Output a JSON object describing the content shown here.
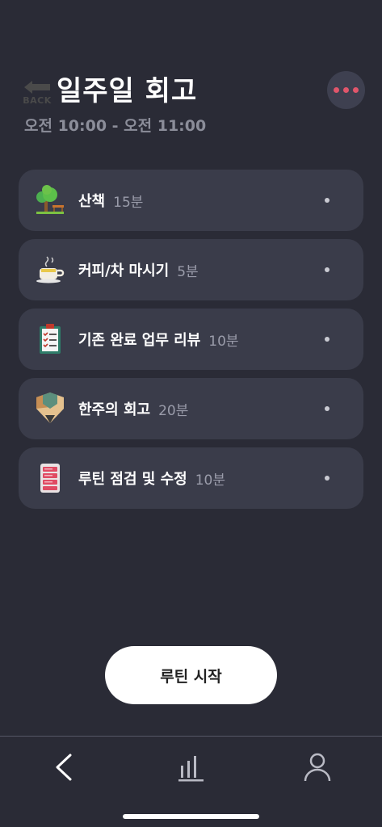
{
  "header": {
    "back_mini_label": "BACK",
    "title": "일주일 회고",
    "time_range": "오전 10:00 - 오전 11:00"
  },
  "colors": {
    "background": "#2a2b36",
    "card": "#3a3c4a",
    "accent_dots": "#e0566b",
    "muted_text": "#8b8d99"
  },
  "items": [
    {
      "icon": "tree-bench-icon",
      "name": "산책",
      "duration": "15분"
    },
    {
      "icon": "coffee-cup-icon",
      "name": "커피/차 마시기",
      "duration": "5분"
    },
    {
      "icon": "checklist-clipboard-icon",
      "name": "기존 완료 업무 리뷰",
      "duration": "10분"
    },
    {
      "icon": "pencil-tip-icon",
      "name": "한주의 회고",
      "duration": "20분"
    },
    {
      "icon": "routine-list-icon",
      "name": "루틴 점검 및 수정",
      "duration": "10분"
    }
  ],
  "start_button_label": "루틴 시작",
  "tabbar": [
    {
      "icon": "back-chevron-icon"
    },
    {
      "icon": "bar-chart-icon"
    },
    {
      "icon": "profile-icon"
    }
  ]
}
